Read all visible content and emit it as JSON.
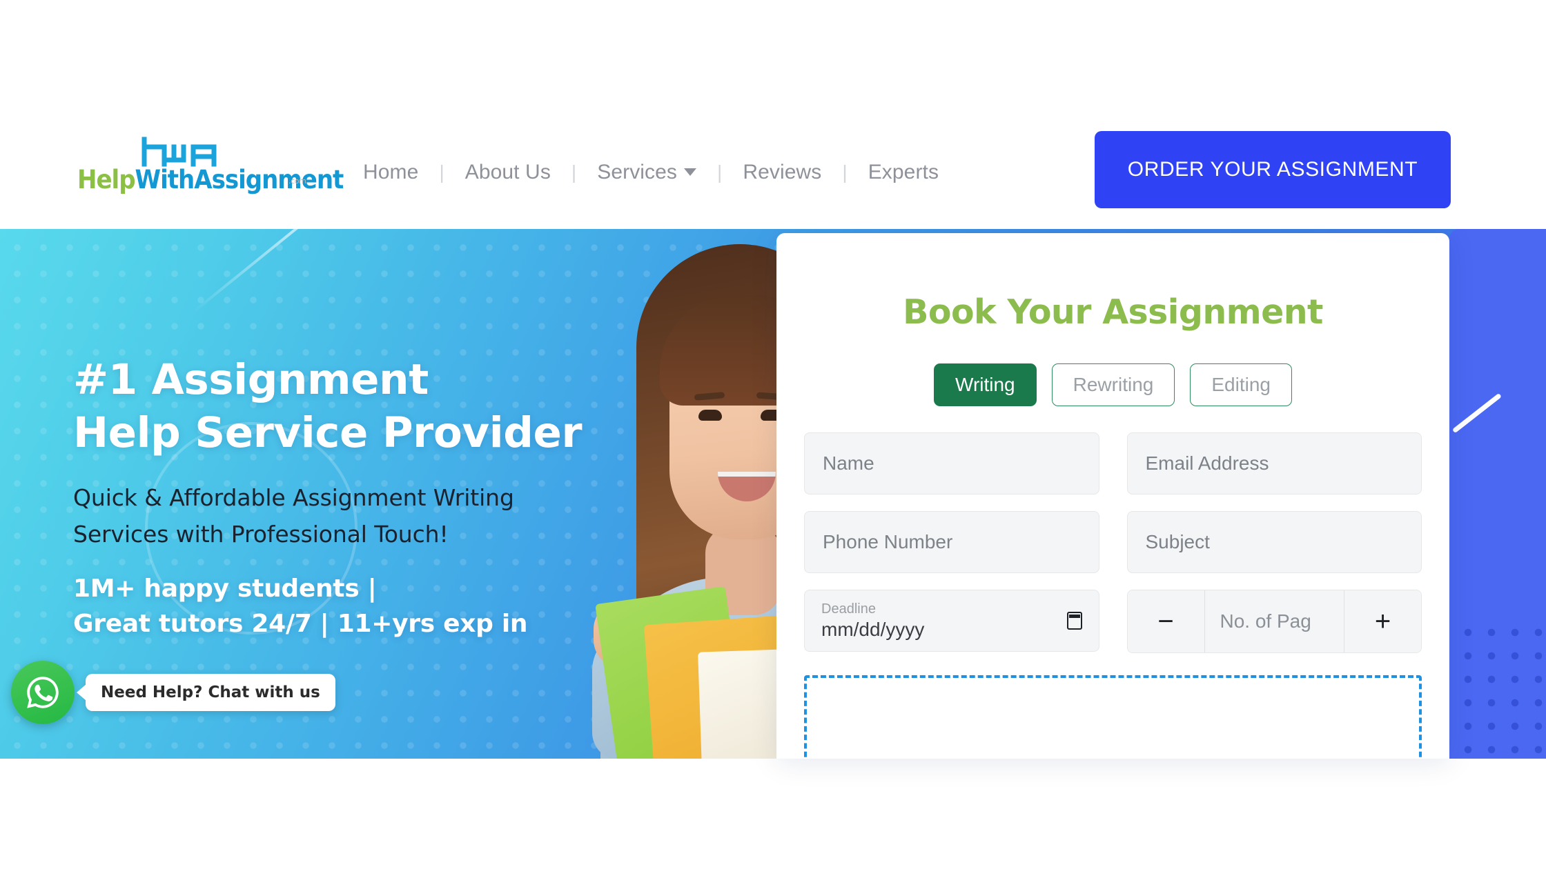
{
  "header": {
    "logo": {
      "mark": "hwa-monogram-icon",
      "help": "Help",
      "rest": "WithAssignment",
      "tld": ".com"
    },
    "nav": [
      {
        "label": "Home",
        "has_caret": false
      },
      {
        "label": "About Us",
        "has_caret": false
      },
      {
        "label": "Services",
        "has_caret": true
      },
      {
        "label": "Reviews",
        "has_caret": false
      },
      {
        "label": "Experts",
        "has_caret": false
      }
    ],
    "separator": "|",
    "cta": "ORDER YOUR ASSIGNMENT"
  },
  "hero": {
    "title_line1": "#1 Assignment",
    "title_line2": "Help Service Provider",
    "sub_line1": "Quick & Affordable Assignment Writing",
    "sub_line2": "Services with Professional Touch!",
    "stats_line1": "1M+ happy students |",
    "stats_line2": "Great tutors 24/7 | 11+yrs exp in"
  },
  "form": {
    "title": "Book Your Assignment",
    "types": [
      {
        "label": "Writing",
        "active": true
      },
      {
        "label": "Rewriting",
        "active": false
      },
      {
        "label": "Editing",
        "active": false
      }
    ],
    "fields": {
      "name": {
        "placeholder": "Name",
        "value": ""
      },
      "email": {
        "placeholder": "Email Address",
        "value": ""
      },
      "phone": {
        "placeholder": "Phone Number",
        "value": ""
      },
      "subject": {
        "placeholder": "Subject",
        "value": ""
      },
      "deadline": {
        "label": "Deadline",
        "value": "mm/dd/yyyy"
      },
      "pages": {
        "placeholder": "No. of Pag",
        "value": "",
        "minus": "−",
        "plus": "+"
      }
    }
  },
  "chat": {
    "icon": "whatsapp-icon",
    "tooltip": "Need Help? Chat with us"
  },
  "colors": {
    "cta_blue": "#2F43F4",
    "panel_blue": "#4A68F2",
    "form_title_green": "#8CBC4E",
    "active_tab_green": "#1B7A4C",
    "logo_green": "#8CC044",
    "logo_blue": "#1398D4",
    "dropzone_blue": "#2091E0",
    "whatsapp_green": "#25B843"
  }
}
